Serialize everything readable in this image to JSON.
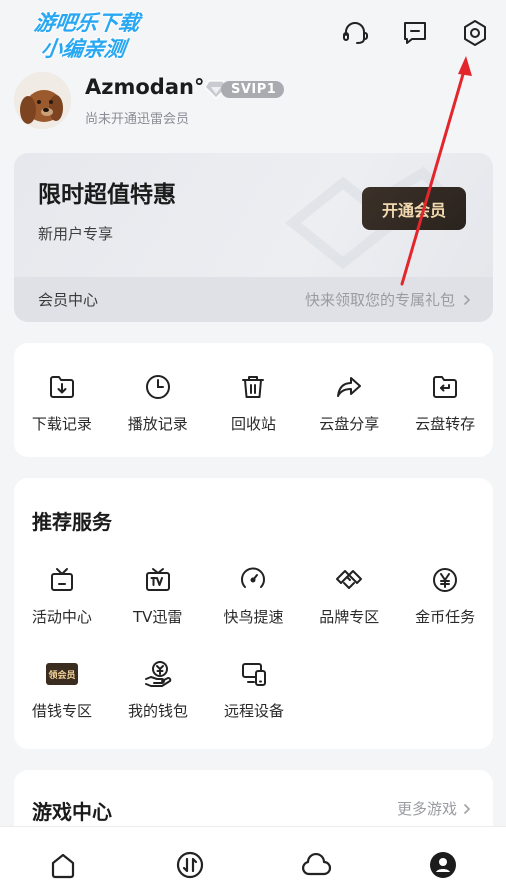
{
  "watermark": {
    "line1": "游吧乐下载",
    "line2": "小编亲测"
  },
  "header": {
    "icons": [
      "headset-icon",
      "message-icon",
      "settings-icon"
    ]
  },
  "profile": {
    "username": "Azmodan°",
    "badge": "SVIP1",
    "status": "尚未开通迅雷会员"
  },
  "vip": {
    "title": "限时超值特惠",
    "subtitle": "新用户专享",
    "button": "开通会员",
    "center_label": "会员中心",
    "promo_text": "快来领取您的专属礼包"
  },
  "tools": [
    {
      "label": "下载记录",
      "icon": "download-folder-icon"
    },
    {
      "label": "播放记录",
      "icon": "clock-icon"
    },
    {
      "label": "回收站",
      "icon": "trash-icon"
    },
    {
      "label": "云盘分享",
      "icon": "share-arrow-icon"
    },
    {
      "label": "云盘转存",
      "icon": "folder-transfer-icon"
    }
  ],
  "services": {
    "title": "推荐服务",
    "items": [
      {
        "label": "活动中心",
        "icon": "tv-box-icon"
      },
      {
        "label": "TV迅雷",
        "icon": "tv-icon"
      },
      {
        "label": "快鸟提速",
        "icon": "speedometer-icon"
      },
      {
        "label": "品牌专区",
        "icon": "handshake-icon"
      },
      {
        "label": "金币任务",
        "icon": "yen-coin-icon"
      },
      {
        "label": "借钱专区",
        "icon": "loan-badge-icon",
        "badge": "领会员"
      },
      {
        "label": "我的钱包",
        "icon": "wallet-hand-icon"
      },
      {
        "label": "远程设备",
        "icon": "remote-device-icon"
      }
    ]
  },
  "games": {
    "title": "游戏中心",
    "more": "更多游戏"
  },
  "nav": [
    "home-icon",
    "transfer-icon",
    "cloud-icon",
    "profile-icon"
  ],
  "colors": {
    "accent_arrow": "#e3262b",
    "vip_button": "#2f2721",
    "watermark": "#28a7f2"
  }
}
